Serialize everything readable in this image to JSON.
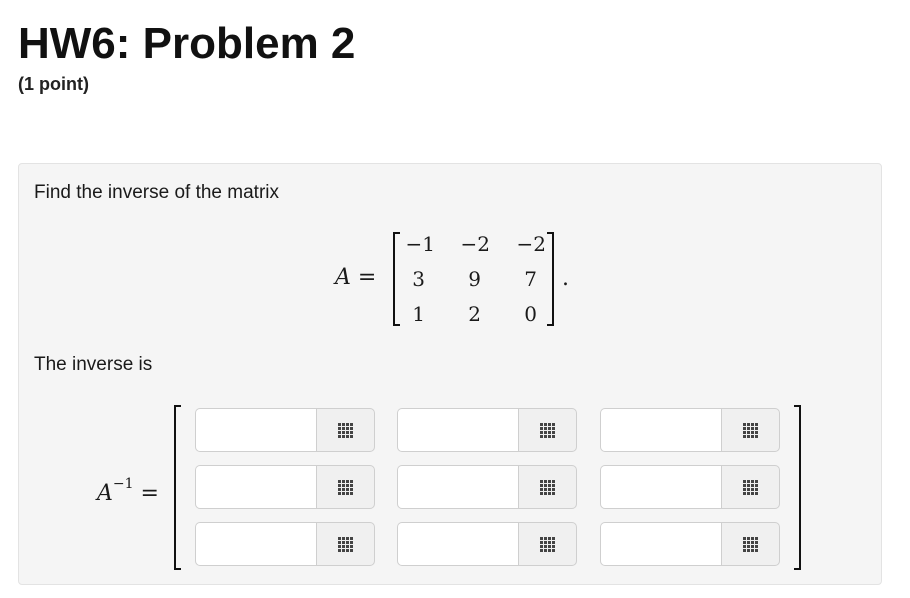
{
  "header": {
    "title": "HW6: Problem 2",
    "points": "(1 point)"
  },
  "problem": {
    "prompt": "Find the inverse of the matrix",
    "matrix_name": "A",
    "equals": "=",
    "matrix": [
      [
        "−1",
        "−2",
        "−2"
      ],
      [
        "3",
        "9",
        "7"
      ],
      [
        "1",
        "2",
        "0"
      ]
    ],
    "trailing_period": ".",
    "answer_prompt": "The inverse is",
    "inverse_name": "A",
    "inverse_exponent": "−1",
    "answer_values": [
      [
        "",
        "",
        ""
      ],
      [
        "",
        "",
        ""
      ],
      [
        "",
        "",
        ""
      ]
    ]
  },
  "icons": {
    "grid_button": "matrix-grid-icon"
  },
  "colors": {
    "panel_bg": "#f5f5f5",
    "panel_border": "#e3e3e3",
    "input_border": "#cfcfcf",
    "button_bg": "#f0f0f0",
    "icon": "#444444"
  }
}
